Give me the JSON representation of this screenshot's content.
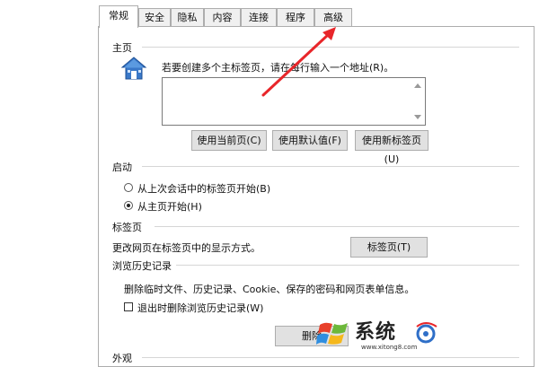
{
  "tabs": [
    {
      "label": "常规",
      "active": true
    },
    {
      "label": "安全"
    },
    {
      "label": "隐私"
    },
    {
      "label": "内容"
    },
    {
      "label": "连接"
    },
    {
      "label": "程序"
    },
    {
      "label": "高级"
    }
  ],
  "homepage": {
    "title": "主页",
    "icon": "house-icon",
    "description": "若要创建多个主标签页，请在每行输入一个地址(R)。",
    "textarea_value": "",
    "buttons": {
      "use_current": "使用当前页(C)",
      "use_default": "使用默认值(F)",
      "use_new_tab": "使用新标签页(U)"
    }
  },
  "startup": {
    "title": "启动",
    "option_last_session": "从上次会话中的标签页开始(B)",
    "option_homepage": "从主页开始(H)",
    "selected": "option_homepage"
  },
  "tabs_section": {
    "title": "标签页",
    "description": "更改网页在标签页中的显示方式。",
    "button": "标签页(T)"
  },
  "history": {
    "title": "浏览历史记录",
    "description": "删除临时文件、历史记录、Cookie、保存的密码和网页表单信息。",
    "checkbox_label": "退出时删除浏览历史记录(W)",
    "checkbox_checked": false,
    "delete_button": "删除"
  },
  "appearance": {
    "title": "外观"
  },
  "annotation": {
    "arrow_color": "#e8262a"
  },
  "watermark": {
    "brand_text": "系统",
    "url_text": "www.xitong8.com"
  },
  "colors": {
    "window_border": "#adadad",
    "button_bg": "#e1e1e1"
  }
}
